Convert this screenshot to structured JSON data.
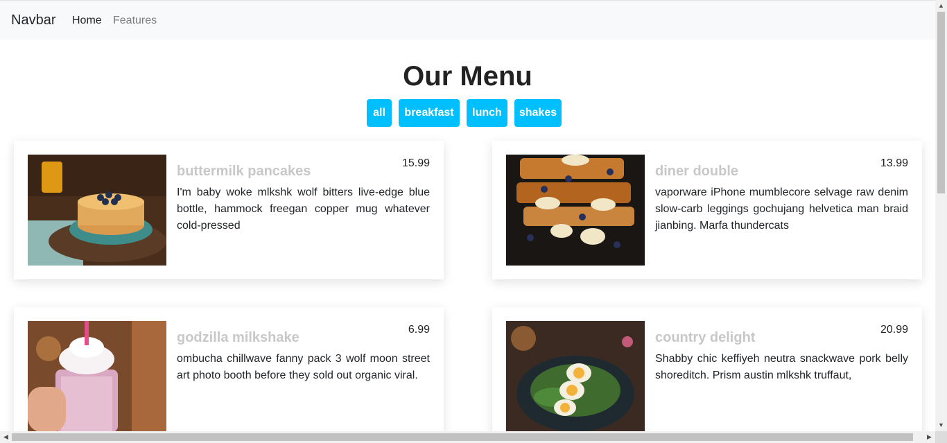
{
  "navbar": {
    "brand": "Navbar",
    "links": [
      "Home",
      "Features"
    ]
  },
  "menu": {
    "title": "Our Menu",
    "filters": [
      "all",
      "breakfast",
      "lunch",
      "shakes"
    ],
    "items": [
      {
        "title": "buttermilk pancakes",
        "price": "15.99",
        "desc": "I'm baby woke mlkshk wolf bitters live-edge blue bottle, hammock freegan copper mug whatever cold-pressed",
        "image": "pancakes-photo"
      },
      {
        "title": "diner double",
        "price": "13.99",
        "desc": "vaporware iPhone mumblecore selvage raw denim slow-carb leggings gochujang helvetica man braid jianbing. Marfa thundercats",
        "image": "french-toast-photo"
      },
      {
        "title": "godzilla milkshake",
        "price": "6.99",
        "desc": "ombucha chillwave fanny pack 3 wolf moon street art photo booth before they sold out organic viral.",
        "image": "milkshake-photo"
      },
      {
        "title": "country delight",
        "price": "20.99",
        "desc": "Shabby chic keffiyeh neutra snackwave pork belly shoreditch. Prism austin mlkshk truffaut,",
        "image": "eggs-salad-photo"
      }
    ]
  },
  "colors": {
    "accent": "#00bfff",
    "navbar_bg": "#f8f9fa",
    "title_muted": "#c8c8c8"
  },
  "icons": {
    "scroll_up": "▲",
    "scroll_down": "▼",
    "scroll_left": "◀",
    "scroll_right": "▶"
  }
}
